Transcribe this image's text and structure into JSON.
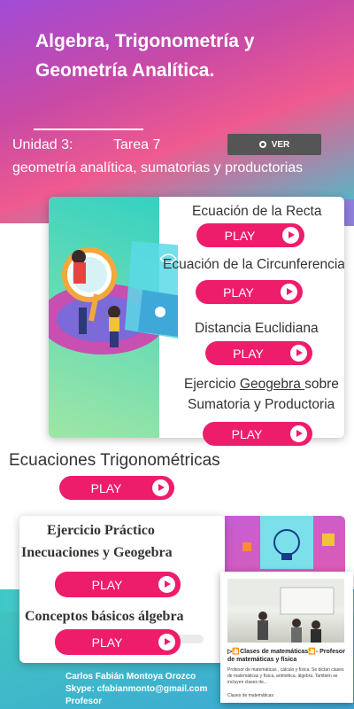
{
  "header": {
    "title": "Algebra, Trigonometría y Geometría Analítica.",
    "unidad": "Unidad 3:",
    "tarea": "Tarea 7",
    "tema": "geometría analítica, sumatorias y productorias",
    "ver_label": "VER"
  },
  "section1": {
    "items": [
      {
        "title": "Ecuación de la Recta",
        "play": "PLAY"
      },
      {
        "title": "Ecuación de la Circunferencia",
        "play": "PLAY"
      },
      {
        "title": "Distancia Euclidiana",
        "play": "PLAY"
      },
      {
        "title_pre": "Ejercicio ",
        "title_link": "Geogebra ",
        "title_post": "sobre",
        "title_line2": "Sumatoria y Productoria",
        "play": "PLAY"
      }
    ]
  },
  "trig": {
    "title": "Ecuaciones Trigonométricas",
    "play": "PLAY"
  },
  "section2": {
    "items": [
      {
        "title_line1": "Ejercicio Práctico",
        "title_line2": "Inecuaciones y Geogebra",
        "play": "PLAY"
      },
      {
        "title": "Conceptos básicos  álgebra",
        "play": "PLAY"
      }
    ]
  },
  "footer": {
    "name": "Carlos Fabián Montoya Orozco",
    "skype": "Skype: cfabianmonto@gmail.com",
    "role": "Profesor"
  },
  "video": {
    "title": "▷🎦Clases de matemáticas🎦- Profesor de matemáticas y física",
    "description": "Profesor de matemáticas , cálculo y física. Se dictan clases de matemáticas y física, aritmética, álgebra. También se incluyen clases de...",
    "channel": "Clases de matemáticas"
  },
  "colors": {
    "accent": "#ee1d6b",
    "teal": "#3ec6cf",
    "purple": "#a24bd6"
  }
}
